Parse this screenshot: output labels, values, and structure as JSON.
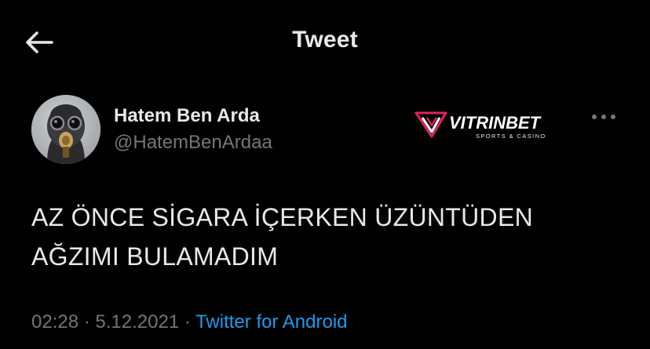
{
  "header": {
    "back_icon": "arrow-left-icon",
    "title": "Tweet"
  },
  "tweet": {
    "author": {
      "name": "Hatem Ben Arda",
      "handle": "@HatemBenArdaa",
      "avatar_icon": "gas-mask-avatar"
    },
    "brand_logo": {
      "text": "VITRINBET",
      "tagline": "SPORTS & CASINO",
      "accent_color": "#e0245e"
    },
    "more_icon": "more-dots-icon",
    "text_lines": [
      "AZ ÖNCE SİGARA İÇERKEN ÜZÜNTÜDEN",
      "AĞZIMI BULAMADIM"
    ],
    "time": "02:28",
    "separator": "·",
    "date": "5.12.2021",
    "source": "Twitter for Android"
  },
  "colors": {
    "background": "#000000",
    "text_primary": "#e7e9ea",
    "text_secondary": "#71767b",
    "link": "#1d9bf0"
  }
}
